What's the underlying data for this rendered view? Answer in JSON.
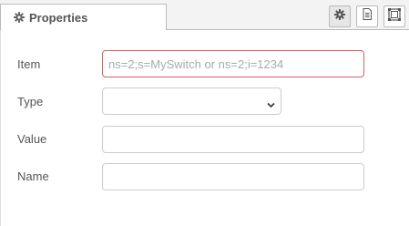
{
  "tab": {
    "label": "Properties",
    "icon": "gear-icon"
  },
  "toolbar": {
    "buttons": [
      {
        "icon": "gear-icon",
        "active": true
      },
      {
        "icon": "document-icon",
        "active": false
      },
      {
        "icon": "frame-icon",
        "active": false
      }
    ]
  },
  "fields": {
    "item": {
      "label": "Item",
      "value": "",
      "placeholder": "ns=2;s=MySwitch or ns=2;i=1234"
    },
    "type": {
      "label": "Type",
      "value": ""
    },
    "value": {
      "label": "Value",
      "value": ""
    },
    "name": {
      "label": "Name",
      "value": ""
    }
  },
  "colors": {
    "invalid_border": "#d6615e",
    "tab_bar_bg": "#f3f3f3"
  }
}
